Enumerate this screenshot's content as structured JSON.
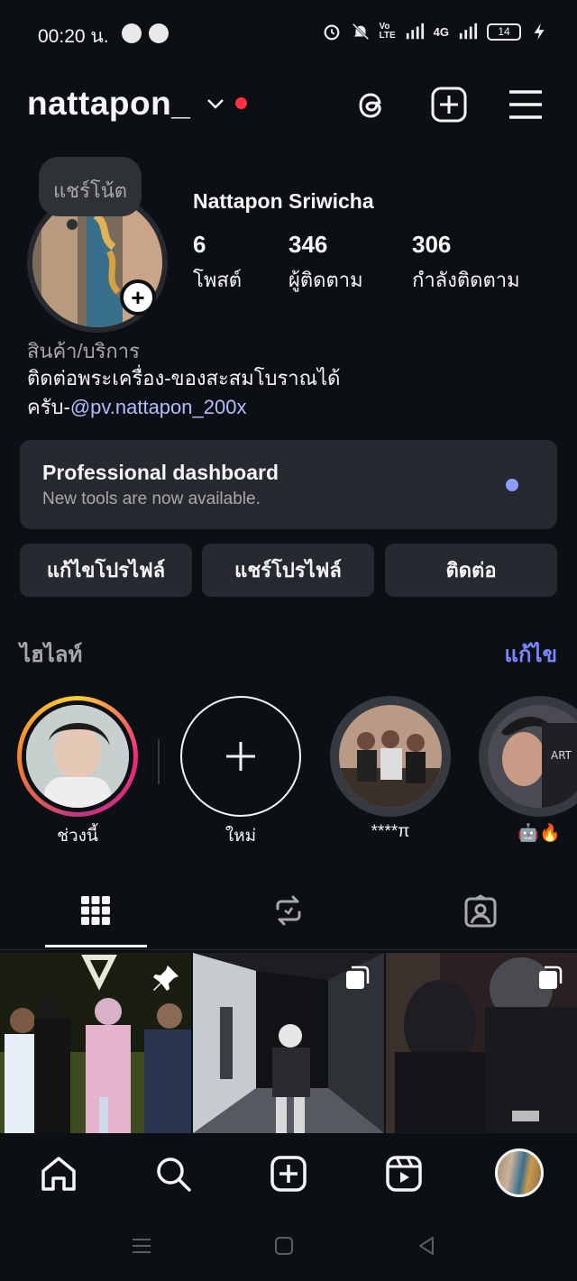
{
  "status_bar": {
    "time": "00:20 น.",
    "network": "4G",
    "battery": "14"
  },
  "header": {
    "username": "nattapon_"
  },
  "profile": {
    "note": "แชร์โน้ต",
    "full_name": "Nattapon Sriwicha",
    "stats": [
      {
        "value": "6",
        "label": "โพสต์"
      },
      {
        "value": "346",
        "label": "ผู้ติดตาม"
      },
      {
        "value": "306",
        "label": "กำลังติดตาม"
      }
    ],
    "category": "สินค้า/บริการ",
    "bio_line1": "ติดต่อพระเครื่อง-ของสะสมโบราณได้",
    "bio_line2_prefix": "ครับ-",
    "bio_mention": "@pv.nattapon_200x"
  },
  "dashboard": {
    "title": "Professional dashboard",
    "subtitle": "New tools are now available."
  },
  "actions": {
    "edit_profile": "แก้ไขโปรไฟล์",
    "share_profile": "แชร์โปรไฟล์",
    "contact": "ติดต่อ"
  },
  "highlights": {
    "title": "ไฮไลท์",
    "edit": "แก้ไข",
    "items": [
      {
        "label": "ช่วงนี้"
      },
      {
        "label": "ใหม่"
      },
      {
        "label": "****π"
      },
      {
        "label": "🤖🔥"
      }
    ]
  },
  "colors": {
    "background": "#0c1014",
    "surface": "#262a30",
    "accent_link": "#7c87ff",
    "mention": "#b6bbff",
    "notification_dot": "#ff3040"
  }
}
